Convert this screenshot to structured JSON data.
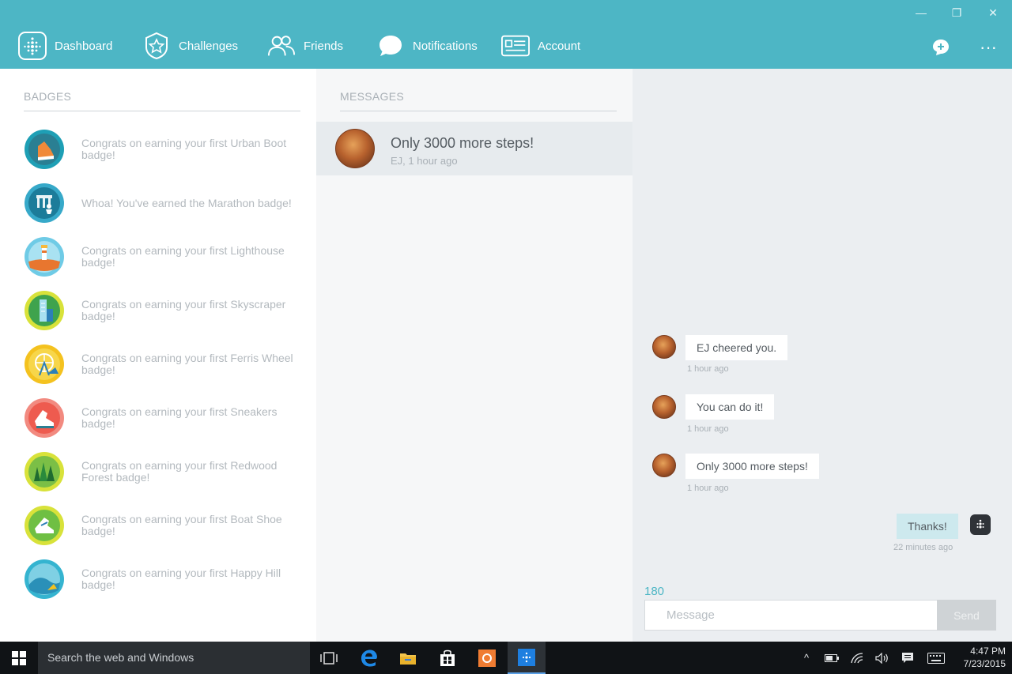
{
  "window_controls": {
    "minimize": "—",
    "restore": "❐",
    "close": "✕"
  },
  "nav": [
    {
      "label": "Dashboard",
      "icon": "dashboard-dots-icon"
    },
    {
      "label": "Challenges",
      "icon": "star-shield-icon"
    },
    {
      "label": "Friends",
      "icon": "friends-icon"
    },
    {
      "label": "Notifications",
      "icon": "speech-bubble-icon"
    },
    {
      "label": "Account",
      "icon": "id-card-icon"
    }
  ],
  "top_actions": {
    "new_message_icon": "add-message-icon",
    "more_icon": "more-icon",
    "more_glyph": "···"
  },
  "badges": {
    "title": "BADGES",
    "items": [
      {
        "text": "Congrats on earning your first Urban Boot badge!",
        "icon": "urban-boot-badge-icon",
        "color": "#1e9fb5"
      },
      {
        "text": "Whoa! You've earned the Marathon badge!",
        "icon": "marathon-badge-icon",
        "color": "#37a9c9"
      },
      {
        "text": "Congrats on earning your first Lighthouse badge!",
        "icon": "lighthouse-badge-icon",
        "color": "#4db8d8"
      },
      {
        "text": "Congrats on earning your first Skyscraper badge!",
        "icon": "skyscraper-badge-icon",
        "color": "#8cc63f"
      },
      {
        "text": "Congrats on earning your first Ferris Wheel badge!",
        "icon": "ferris-wheel-badge-icon",
        "color": "#f2c12e"
      },
      {
        "text": "Congrats on earning your first Sneakers badge!",
        "icon": "sneakers-badge-icon",
        "color": "#f06b5e"
      },
      {
        "text": "Congrats on earning your first Redwood Forest badge!",
        "icon": "redwood-forest-badge-icon",
        "color": "#2f8f3a"
      },
      {
        "text": "Congrats on earning your first Boat Shoe badge!",
        "icon": "boat-shoe-badge-icon",
        "color": "#7bc043"
      },
      {
        "text": "Congrats on earning your first Happy Hill badge!",
        "icon": "happy-hill-badge-icon",
        "color": "#35b4d0"
      }
    ]
  },
  "messages": {
    "title": "MESSAGES",
    "items": [
      {
        "title": "Only 3000 more steps!",
        "subtitle": "EJ, 1 hour ago"
      }
    ]
  },
  "chat": {
    "bubbles": [
      {
        "text": "EJ cheered you.",
        "time": "1 hour ago",
        "from": "EJ"
      },
      {
        "text": "You can do it!",
        "time": "1 hour ago",
        "from": "EJ"
      },
      {
        "text": "Only 3000 more steps!",
        "time": "1 hour ago",
        "from": "EJ"
      },
      {
        "text": "Thanks!",
        "time": "22 minutes ago",
        "from": "me"
      }
    ],
    "char_count": "180",
    "input_placeholder": "Message",
    "send_label": "Send"
  },
  "taskbar": {
    "search_placeholder": "Search the web and Windows",
    "apps": [
      "task-view-icon",
      "edge-icon",
      "file-explorer-icon",
      "store-icon",
      "orange-app-icon",
      "fitbit-app-icon"
    ],
    "tray": {
      "chevron": "^",
      "time": "4:47 PM",
      "date": "7/23/2015"
    }
  }
}
